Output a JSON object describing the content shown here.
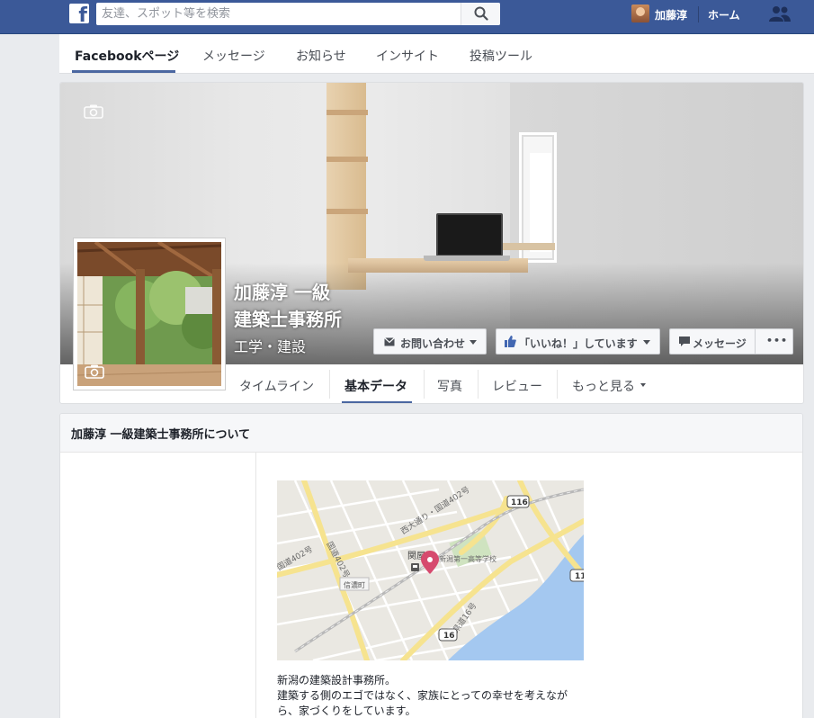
{
  "topbar": {
    "search_placeholder": "友達、スポット等を検索",
    "user_name": "加藤淳",
    "home_label": "ホーム"
  },
  "page_nav": {
    "tabs": [
      {
        "label": "Facebookページ",
        "active": true
      },
      {
        "label": "メッセージ"
      },
      {
        "label": "お知らせ"
      },
      {
        "label": "インサイト"
      },
      {
        "label": "投稿ツール"
      }
    ]
  },
  "page": {
    "name_line1": "加藤淳 一級",
    "name_line2": "建築士事務所",
    "category": "工学・建設"
  },
  "actions": {
    "contact": "お問い合わせ",
    "like": "「いいね！」しています",
    "message": "メッセージ",
    "more": "•••"
  },
  "subtabs": [
    {
      "label": "タイムライン"
    },
    {
      "label": "基本データ",
      "active": true
    },
    {
      "label": "写真"
    },
    {
      "label": "レビュー"
    },
    {
      "label": "もっと見る"
    }
  ],
  "about": {
    "title": "加藤淳 一級建築士事務所について",
    "map": {
      "labels": {
        "road_nishiodori": "西大通り・国道402号",
        "road_402_left": "国道402号",
        "road_402_mid": "国道402号",
        "station": "関屋",
        "school": "新潟第一高等学校",
        "shinanomachi": "信濃町",
        "route16": "県道16号",
        "shield_116": "116",
        "shield_16": "16",
        "shield_11": "11"
      }
    },
    "description": [
      "新潟の建築設計事務所。",
      "建築する側のエゴではなく、家族にとっての幸せを考えなが",
      "ら、家づくりをしています。"
    ]
  },
  "colors": {
    "brand": "#3b5998",
    "accent_underline": "#4b67a1",
    "map_water": "#a4c8f0",
    "map_pin": "#d64a6e"
  }
}
